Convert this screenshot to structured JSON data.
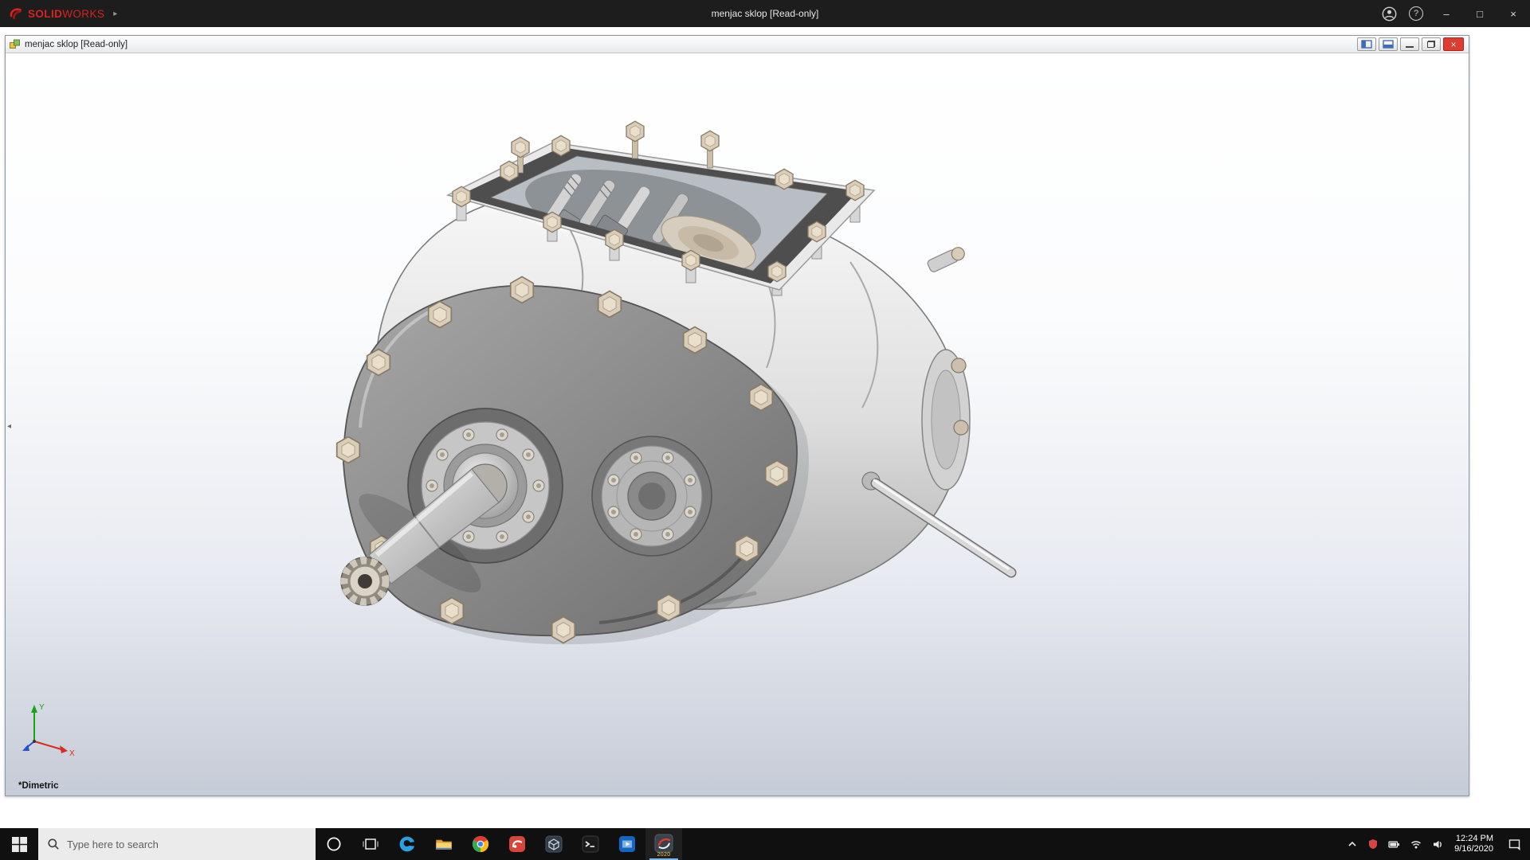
{
  "app": {
    "brand_solid": "SOLID",
    "brand_works": "WORKS",
    "menu_arrow": "▸",
    "window_title": "menjac sklop [Read-only]",
    "controls": {
      "help": "?",
      "minimize": "–",
      "maximize": "□",
      "close": "×"
    }
  },
  "document": {
    "title": "menjac sklop [Read-only]",
    "view_label": "*Dimetric",
    "flyout_arrow": "◂",
    "controls": {
      "close": "×"
    }
  },
  "viewport": {
    "triad_x": "X",
    "triad_y": "Y"
  },
  "taskbar": {
    "search_placeholder": "Type here to search",
    "solidworks_year": "2020",
    "clock_time": "12:24 PM",
    "clock_date": "9/16/2020"
  },
  "colors": {
    "brand_red": "#d6241c",
    "app_titlebar_bg": "#1d1d1d",
    "taskbar_bg": "#101010",
    "doc_close_red": "#df3b30",
    "active_app_underline": "#76b9ed",
    "viewport_gradient_top": "#ffffff",
    "viewport_gradient_bottom": "#c6ccd7"
  }
}
